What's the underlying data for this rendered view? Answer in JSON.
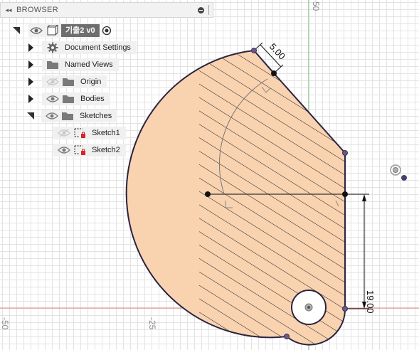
{
  "browser": {
    "title": "BROWSER",
    "root": {
      "name": "기출2 v0"
    },
    "items": [
      {
        "label": "Document Settings",
        "icon": "gear-icon",
        "visible": null,
        "expandable": true,
        "expanded": false
      },
      {
        "label": "Named Views",
        "icon": "folder-icon",
        "visible": null,
        "expandable": true,
        "expanded": false
      },
      {
        "label": "Origin",
        "icon": "folder-icon",
        "visible": false,
        "expandable": true,
        "expanded": false
      },
      {
        "label": "Bodies",
        "icon": "folder-icon",
        "visible": true,
        "expandable": true,
        "expanded": false
      },
      {
        "label": "Sketches",
        "icon": "folder-icon",
        "visible": true,
        "expandable": true,
        "expanded": true
      },
      {
        "label": "Sketch1",
        "icon": "sketch-icon",
        "visible": false,
        "expandable": false
      },
      {
        "label": "Sketch2",
        "icon": "sketch-icon",
        "visible": true,
        "expandable": false
      }
    ]
  },
  "canvas": {
    "axis_labels": {
      "x_neg50": "-50",
      "x_neg25": "-25",
      "y_top": "50"
    },
    "dimensions": {
      "angled": "5.00",
      "vertical": "19.00"
    },
    "colors": {
      "profile_fill": "#f9d2b0",
      "profile_stroke": "#2a2440",
      "hatch": "#1c1c1c",
      "x_axis": "#e08080",
      "y_axis": "#7fc07f",
      "sketch_point": "#6a5a8a"
    }
  }
}
